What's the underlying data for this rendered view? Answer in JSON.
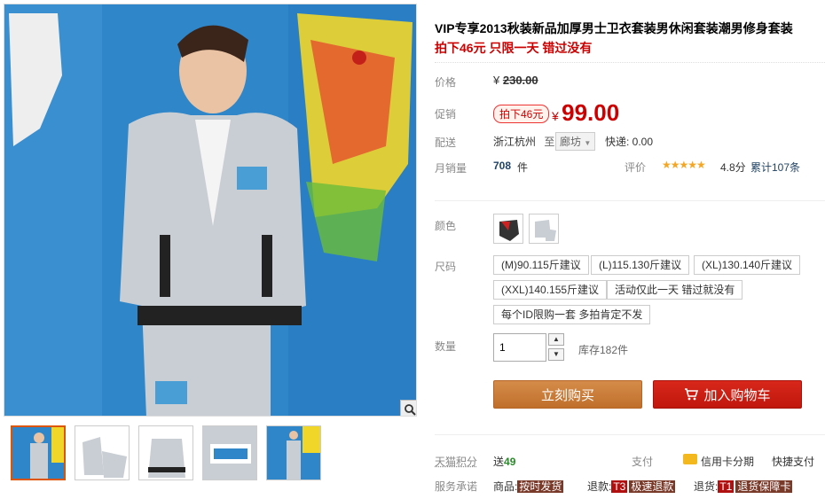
{
  "product": {
    "title": "VIP专享2013秋装新品加厚男士卫衣套装男休闲套装潮男修身套装",
    "promo": "拍下46元 只限一天 错过没有"
  },
  "price": {
    "label": "价格",
    "currency": "¥",
    "original": "230.00",
    "promo_label": "促销",
    "promo_tag": "拍下46元",
    "current": "99.00"
  },
  "shipping": {
    "label": "配送",
    "from": "浙江杭州",
    "to_word": "至",
    "to": "廊坊",
    "fee": "快递: 0.00"
  },
  "sales": {
    "label": "月销量",
    "count": "708",
    "unit": "件",
    "rating_label": "评价",
    "stars": "★★★★★",
    "rating": "4.8分",
    "reviews": "累计107条"
  },
  "options": {
    "color_label": "颜色",
    "size_label": "尺码",
    "sizes": [
      "(M)90.115斤建议",
      "(L)115.130斤建议",
      "(XL)130.140斤建议",
      "(XXL)140.155斤建议",
      "活动仅此一天 错过就没有",
      "每个ID限购一套 多拍肯定不发"
    ]
  },
  "quantity": {
    "label": "数量",
    "value": "1",
    "up": "▲",
    "down": "▼",
    "stock": "库存182件"
  },
  "actions": {
    "buy": "立刻购买",
    "cart": "加入购物车"
  },
  "footer": {
    "points_label": "天猫积分",
    "points_prefix": "送",
    "points": "49",
    "pay_label": "支付",
    "pay1": "信用卡分期",
    "pay2": "快捷支付",
    "service_label": "服务承诺",
    "svc1_label": "商品:",
    "svc1_tag": "按时发货",
    "svc2_label": "退款:",
    "svc2_code": "T3",
    "svc2_tag": "极速退款",
    "svc3_label": "退货:",
    "svc3_code": "T1",
    "svc3_tag": "退货保障卡"
  },
  "colors": {
    "accent_red": "#c00000",
    "buy_orange": "#c87530",
    "cart_red": "#cc1d12",
    "wall_blue": "#2f86c9"
  }
}
